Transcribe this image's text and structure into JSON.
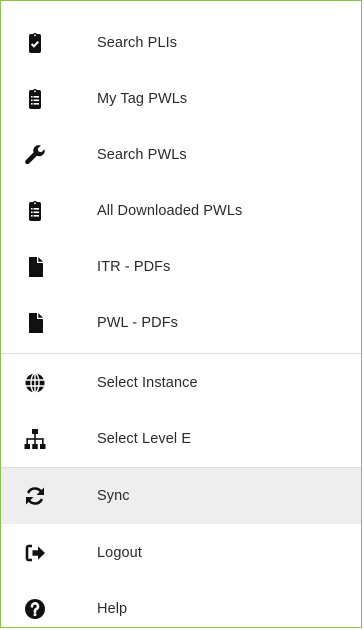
{
  "menu": {
    "items": [
      {
        "label": "Search PLIs",
        "icon": "clipboard-check-icon"
      },
      {
        "label": "My Tag PWLs",
        "icon": "clipboard-list-icon"
      },
      {
        "label": "Search PWLs",
        "icon": "wrench-icon"
      },
      {
        "label": "All Downloaded PWLs",
        "icon": "clipboard-list-icon"
      },
      {
        "label": "ITR - PDFs",
        "icon": "file-icon"
      },
      {
        "label": "PWL - PDFs",
        "icon": "file-icon"
      },
      {
        "label": "Select Instance",
        "icon": "globe-icon"
      },
      {
        "label": "Select Level E",
        "icon": "sitemap-icon"
      },
      {
        "label": "Sync",
        "icon": "sync-icon"
      },
      {
        "label": "Logout",
        "icon": "logout-icon"
      },
      {
        "label": "Help",
        "icon": "help-icon"
      }
    ]
  },
  "colors": {
    "border": "#8bc34a",
    "active_background": "#eeeeee",
    "icon": "#111111",
    "text": "#2a2a2a"
  }
}
